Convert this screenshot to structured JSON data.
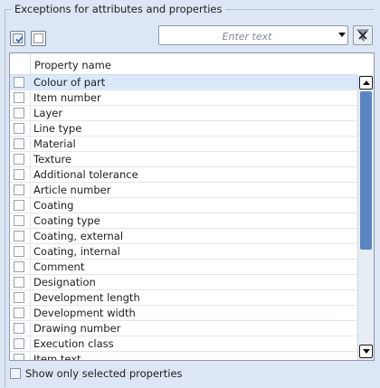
{
  "group": {
    "title": "Exceptions for attributes and properties"
  },
  "toolbar": {
    "select_all_icon": "checked-checkbox-icon",
    "deselect_all_icon": "empty-checkbox-icon",
    "filter_placeholder": "Enter text",
    "filter_value": "",
    "clear_filter_icon": "clear-filter-icon"
  },
  "list": {
    "column_header": "Property name",
    "selected_index": 0,
    "items": [
      {
        "label": "Colour of part",
        "checked": false
      },
      {
        "label": "Item number",
        "checked": false
      },
      {
        "label": "Layer",
        "checked": false
      },
      {
        "label": "Line type",
        "checked": false
      },
      {
        "label": "Material",
        "checked": false
      },
      {
        "label": "Texture",
        "checked": false
      },
      {
        "label": "Additional tolerance",
        "checked": false
      },
      {
        "label": "Article number",
        "checked": false
      },
      {
        "label": "Coating",
        "checked": false
      },
      {
        "label": "Coating type",
        "checked": false
      },
      {
        "label": "Coating, external",
        "checked": false
      },
      {
        "label": "Coating, internal",
        "checked": false
      },
      {
        "label": "Comment",
        "checked": false
      },
      {
        "label": "Designation",
        "checked": false
      },
      {
        "label": "Development length",
        "checked": false
      },
      {
        "label": "Development width",
        "checked": false
      },
      {
        "label": "Drawing number",
        "checked": false
      },
      {
        "label": "Execution class",
        "checked": false
      },
      {
        "label": "Item text",
        "checked": false
      }
    ]
  },
  "footer": {
    "show_only_selected_label": "Show only selected properties",
    "show_only_selected_checked": false
  },
  "colors": {
    "accent": "#5a86c4",
    "selection": "#d9e9fb",
    "background": "#dce6f4"
  }
}
